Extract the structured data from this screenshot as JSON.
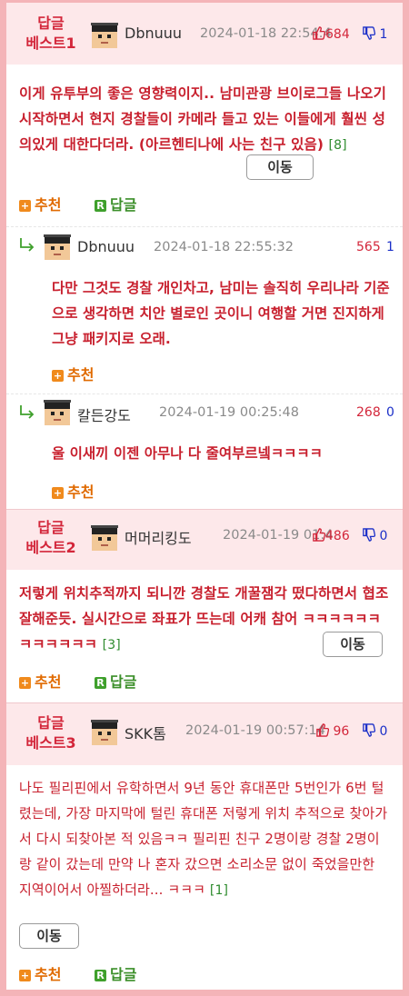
{
  "comments": [
    {
      "best_label_line1": "답글",
      "best_label_line2": "베스트1",
      "user": "Dbnuuu",
      "date": "2024-01-18 22:54:4",
      "up": "684",
      "down": "1",
      "text": "이게 유투부의 좋은 영향력이지.. 남미관광 브이로그들 나오기 시작하면서 현지 경찰들이 카메라 들고 있는 이들에게 훨씬 성의있게 대한다더라. (아르헨티나에 사는 친구 있음)",
      "reply_count": "[8]",
      "move_label": "이동",
      "recommend_label": "추천",
      "reply_label": "답글"
    },
    {
      "best_label_line1": "답글",
      "best_label_line2": "베스트2",
      "user": "머머리킹도",
      "date": "2024-01-19 01:4",
      "up": "486",
      "down": "0",
      "text": "저렇게 위치추적까지 되니깐 경찰도 개꿀잼각 떴다하면서 협조 잘해준듯. 실시간으로 좌표가 뜨는데 어캐 참어 ㅋㅋㅋㅋㅋㅋㅋㅋㅋㅋㅋㅋ",
      "reply_count": "[3]",
      "move_label": "이동",
      "recommend_label": "추천",
      "reply_label": "답글"
    },
    {
      "best_label_line1": "답글",
      "best_label_line2": "베스트3",
      "user": "SKK톰",
      "date": "2024-01-19 00:57:14",
      "up": "96",
      "down": "0",
      "text": "나도 필리핀에서 유학하면서 9년 동안 휴대폰만 5번인가 6번 털렸는데, 가장 마지막에 털린 휴대폰 저렇게 위치 추적으로 찾아가서 다시 되찾아본 적 있음ㅋㅋ 필리핀 친구 2명이랑 경찰 2명이랑 같이 갔는데 만약 나 혼자 갔으면 소리소문 없이 죽었을만한 지역이어서 아찔하더라... ㅋㅋㅋ",
      "reply_count": "[1]",
      "move_label": "이동",
      "recommend_label": "추천",
      "reply_label": "답글"
    }
  ],
  "replies": [
    {
      "user": "Dbnuuu",
      "date": "2024-01-18 22:55:32",
      "up": "565",
      "down": "1",
      "text": "다만 그것도 경찰 개인차고, 남미는 솔직히 우리나라 기준으로 생각하면 치안 별로인 곳이니 여행할 거면 진지하게 그냥 패키지로 오래.",
      "recommend_label": "추천"
    },
    {
      "user": "칼든강도",
      "date": "2024-01-19 00:25:48",
      "up": "268",
      "down": "0",
      "text": "울 이새끼 이젠 아무나 다 줄여부르넼ㅋㅋㅋㅋ",
      "recommend_label": "추천"
    }
  ],
  "colors": {
    "accent_red": "#c8202e",
    "best_bg": "#fde8ea",
    "frame": "#f4b4b8",
    "up_red": "#d3263a",
    "down_blue": "#1b2fc8",
    "recommend_orange": "#f08a1c",
    "reply_green": "#3fa02c"
  },
  "icons": [
    "avatar-icon",
    "thumbs-up-icon",
    "thumbs-down-icon",
    "reply-arrow-icon",
    "plus-icon",
    "r-icon"
  ]
}
